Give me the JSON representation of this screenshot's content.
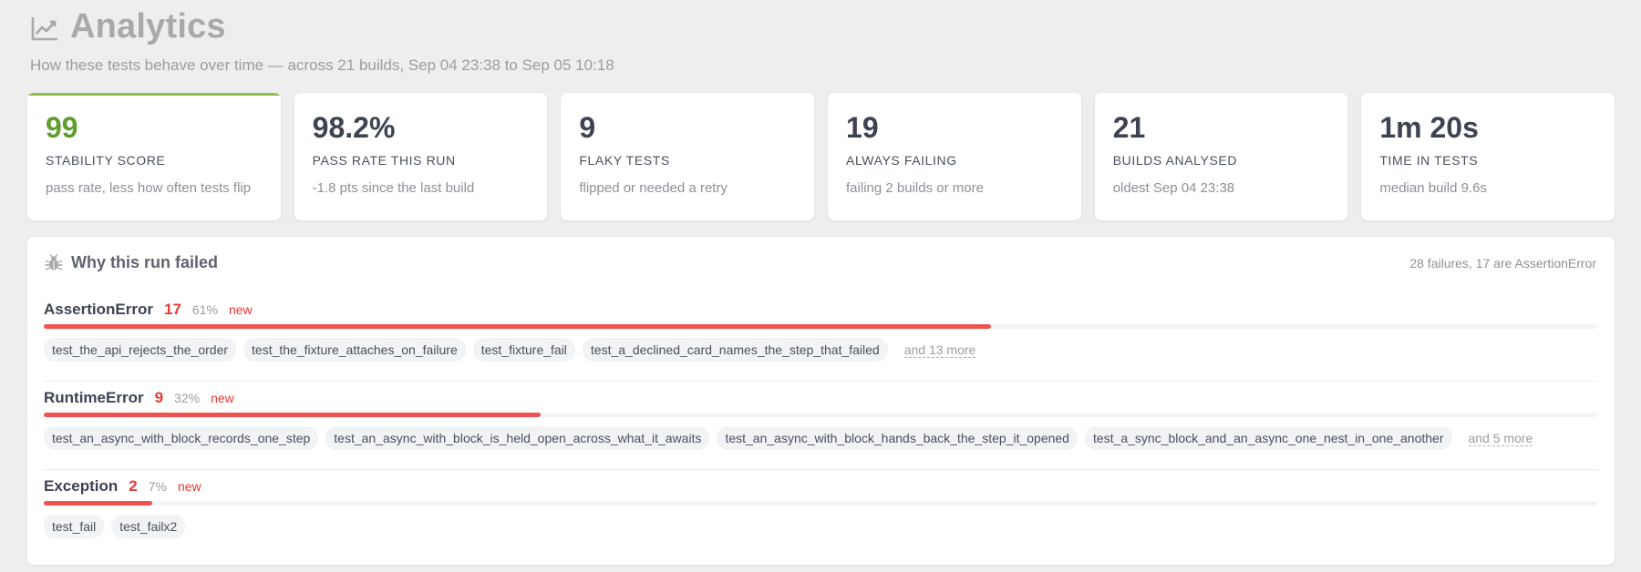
{
  "header": {
    "title": "Analytics",
    "subtitle": "How these tests behave over time — across 21 builds, Sep 04 23:38 to Sep 05 10:18",
    "icon": "trend-chart-icon"
  },
  "stats": [
    {
      "value": "99",
      "label": "STABILITY SCORE",
      "desc": "pass rate, less how often tests flip"
    },
    {
      "value": "98.2%",
      "label": "PASS RATE THIS RUN",
      "desc": "-1.8 pts since the last build"
    },
    {
      "value": "9",
      "label": "FLAKY TESTS",
      "desc": "flipped or needed a retry"
    },
    {
      "value": "19",
      "label": "ALWAYS FAILING",
      "desc": "failing 2 builds or more"
    },
    {
      "value": "21",
      "label": "BUILDS ANALYSED",
      "desc": "oldest Sep 04 23:38"
    },
    {
      "value": "1m 20s",
      "label": "TIME IN TESTS",
      "desc": "median build 9.6s"
    }
  ],
  "colors": {
    "accent_green": "#8bc34a",
    "score_green": "#5e9e2f",
    "error_red": "#e53935",
    "bar_red": "#ef5350"
  },
  "failures": {
    "title": "Why this run failed",
    "icon": "bug-icon",
    "summary": "28 failures, 17 are AssertionError",
    "groups": [
      {
        "name": "AssertionError",
        "count": "17",
        "pct": "61%",
        "tag": "new",
        "share": 0.61,
        "tests": [
          "test_the_api_rejects_the_order",
          "test_the_fixture_attaches_on_failure",
          "test_fixture_fail",
          "test_a_declined_card_names_the_step_that_failed"
        ],
        "more": "and 13 more"
      },
      {
        "name": "RuntimeError",
        "count": "9",
        "pct": "32%",
        "tag": "new",
        "share": 0.32,
        "tests": [
          "test_an_async_with_block_records_one_step",
          "test_an_async_with_block_is_held_open_across_what_it_awaits",
          "test_an_async_with_block_hands_back_the_step_it_opened",
          "test_a_sync_block_and_an_async_one_nest_in_one_another"
        ],
        "more": "and 5 more"
      },
      {
        "name": "Exception",
        "count": "2",
        "pct": "7%",
        "tag": "new",
        "share": 0.07,
        "tests": [
          "test_fail",
          "test_failx2"
        ],
        "more": ""
      }
    ]
  }
}
